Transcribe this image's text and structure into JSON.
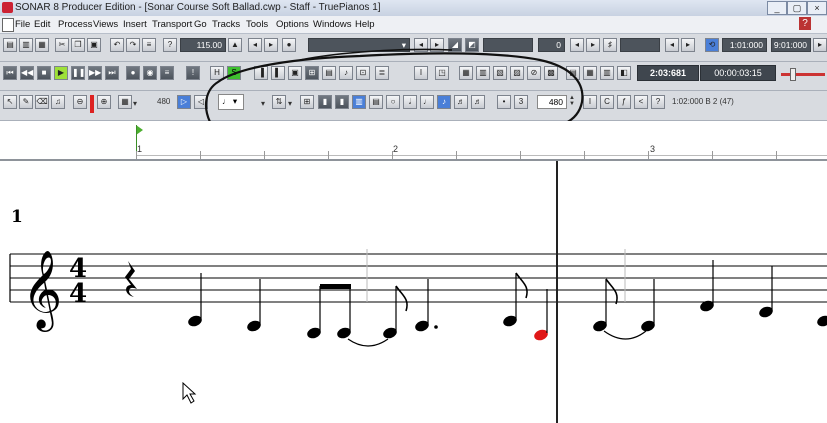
{
  "window": {
    "title": "SONAR 8 Producer Edition - [Sonar Course Soft Ballad.cwp - Staff - TruePianos 1]"
  },
  "menu": {
    "items": [
      "File",
      "Edit",
      "Process",
      "Views",
      "Insert",
      "Transport",
      "Go",
      "Tracks",
      "Tools",
      "Options",
      "Windows",
      "Help"
    ]
  },
  "toolbar1": {
    "tempo": "115.00",
    "meter_fields": [
      "0"
    ],
    "now_time": "1:01:000",
    "end_time": "9:01:000"
  },
  "toolbar2": {
    "solo_label": "S",
    "hi_label": "H",
    "clock_big": "2:03:681",
    "clock_small": "00:00:03:15"
  },
  "toolbar3": {
    "snap_value": "480",
    "duration_field": "480",
    "position_readout": "1:02:000  B 2 (47)",
    "triplet_label": "3"
  },
  "ruler": {
    "measures": [
      "1",
      "2",
      "3"
    ]
  },
  "staff": {
    "measure_number": "1",
    "time_signature_top": "4",
    "time_signature_bottom": "4"
  },
  "colors": {
    "selected_note": "#e01818",
    "annotation_circle": "#111111"
  }
}
